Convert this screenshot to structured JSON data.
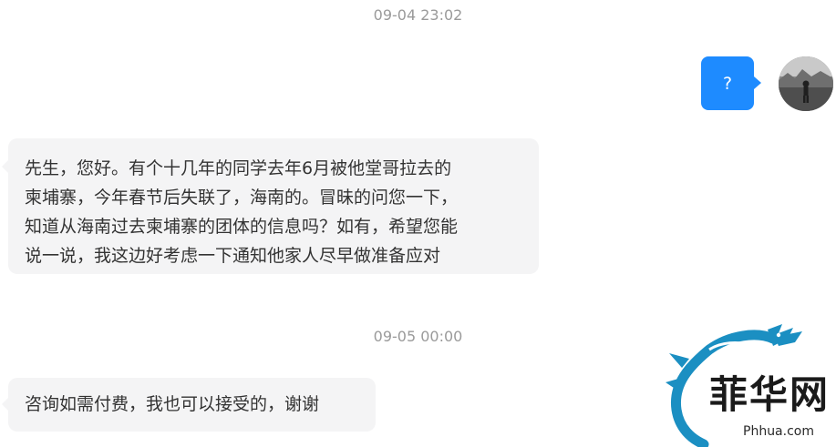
{
  "conversation": {
    "timestamps": [
      "09-04 23:02",
      "09-05 00:00"
    ],
    "outgoing": {
      "text": "?"
    },
    "incoming": [
      {
        "lines": [
          "先生，您好。有个十几年的同学去年6月被他堂哥拉去的",
          "柬埔寨，今年春节后失联了，海南的。冒昧的问您一下，",
          "知道从海南过去柬埔寨的团体的信息吗？如有，希望您能",
          "说一说，我这边好考虑一下通知他家人尽早做准备应对"
        ]
      },
      {
        "text": "咨询如需付费，我也可以接受的，谢谢"
      }
    ]
  },
  "watermark": {
    "logo_text": "菲华网",
    "url": "Phhua.com"
  },
  "colors": {
    "outgoing_bubble": "#1e8bff",
    "incoming_bubble": "#f4f4f5",
    "timestamp_text": "#9a9a9a",
    "dragon_logo": "#1b8fc2"
  },
  "icons": {
    "avatar": "user-avatar-photo",
    "watermark": "dragon-logo"
  }
}
